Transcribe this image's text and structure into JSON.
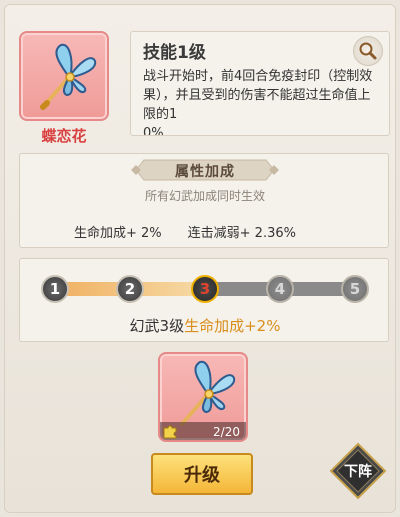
{
  "item": {
    "name": "蝶恋花",
    "icon": "butterfly-key-icon"
  },
  "skill": {
    "title": "技能1级",
    "description": "战斗开始时，前4回合免疫封印（控制效果），并且受到的伤害不能超过生命值上限的1",
    "truncated_line": "0%"
  },
  "attributes": {
    "title": "属性加成",
    "subtitle": "所有幻武加成同时生效",
    "stats": [
      "生命加成+ 2%",
      "连击减弱+ 2.36%"
    ]
  },
  "progress": {
    "nodes": [
      "1",
      "2",
      "3",
      "4",
      "5"
    ],
    "current": 3,
    "label_prefix": "幻武3级",
    "label_highlight": "生命加成+2%"
  },
  "fragments": {
    "count": "2/20"
  },
  "buttons": {
    "upgrade": "升级",
    "unequip": "下阵"
  },
  "colors": {
    "name_red": "#d94040",
    "highlight_orange": "#d98e1a",
    "button_gold": "#f4b637"
  }
}
